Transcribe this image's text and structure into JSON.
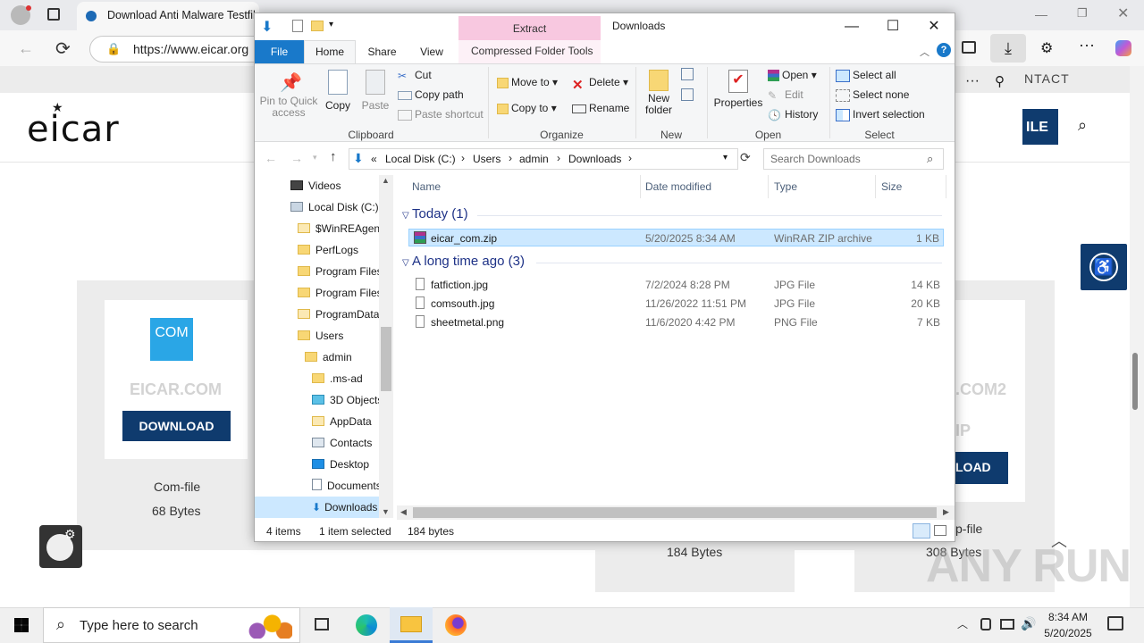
{
  "browser": {
    "tab_title": "Download Anti Malware Testfile",
    "url": "https://www.eicar.org",
    "icons": [
      "profile-icon",
      "tab-actions-icon",
      "back-icon",
      "refresh-icon",
      "site-info-icon",
      "split-screen-icon",
      "collections-icon",
      "downloads-icon",
      "extensions-icon",
      "more-icon",
      "copilot-icon",
      "minimize-icon",
      "restore-icon",
      "close-icon"
    ]
  },
  "site": {
    "nav_contact": "NTACT",
    "logo": "eicar",
    "file_button": "ILE",
    "card1": {
      "icon_text": "COM",
      "title": "EICAR.COM",
      "download": "DOWNLOAD",
      "name": "Com-file",
      "size": "68 Bytes"
    },
    "card4": {
      "title": ".COM2",
      "subtitle": "IP",
      "download": "LOAD",
      "name": "p-file"
    },
    "size3": "184 Bytes",
    "size4": "308 Bytes",
    "watermark": "ANY RUN"
  },
  "explorer": {
    "title": "Downloads",
    "extract_tab": "Extract",
    "compressed_tab": "Compressed Folder Tools",
    "tabs": [
      "File",
      "Home",
      "Share",
      "View"
    ],
    "ribbon": {
      "clipboard": {
        "label": "Clipboard",
        "pin": "Pin to Quick access",
        "copy": "Copy",
        "paste": "Paste",
        "cut": "Cut",
        "copy_path": "Copy path",
        "paste_shortcut": "Paste shortcut"
      },
      "organize": {
        "label": "Organize",
        "move_to": "Move to",
        "copy_to": "Copy to",
        "delete": "Delete",
        "rename": "Rename"
      },
      "new": {
        "label": "New",
        "new_folder": "New folder"
      },
      "open": {
        "label": "Open",
        "properties": "Properties",
        "open": "Open",
        "edit": "Edit",
        "history": "History"
      },
      "select": {
        "label": "Select",
        "select_all": "Select all",
        "select_none": "Select none",
        "invert": "Invert selection"
      }
    },
    "address": {
      "prefix": "«",
      "crumbs": [
        "Local Disk (C:)",
        "Users",
        "admin",
        "Downloads"
      ]
    },
    "search_placeholder": "Search Downloads",
    "nav_items": [
      "Videos",
      "Local Disk (C:)",
      "$WinREAgent",
      "PerfLogs",
      "Program Files",
      "Program Files",
      "ProgramData",
      "Users",
      "admin",
      ".ms-ad",
      "3D Objects",
      "AppData",
      "Contacts",
      "Desktop",
      "Documents",
      "Downloads"
    ],
    "columns": [
      "Name",
      "Date modified",
      "Type",
      "Size"
    ],
    "groups": [
      {
        "title": "Today (1)",
        "files": [
          {
            "name": "eicar_com.zip",
            "date": "5/20/2025 8:34 AM",
            "type": "WinRAR ZIP archive",
            "size": "1 KB"
          }
        ]
      },
      {
        "title": "A long time ago (3)",
        "files": [
          {
            "name": "fatfiction.jpg",
            "date": "7/2/2024 8:28 PM",
            "type": "JPG File",
            "size": "14 KB"
          },
          {
            "name": "comsouth.jpg",
            "date": "11/26/2022 11:51 PM",
            "type": "JPG File",
            "size": "20 KB"
          },
          {
            "name": "sheetmetal.png",
            "date": "11/6/2020 4:42 PM",
            "type": "PNG File",
            "size": "7 KB"
          }
        ]
      }
    ],
    "status": {
      "items": "4 items",
      "selected": "1 item selected",
      "size": "184 bytes"
    }
  },
  "taskbar": {
    "search_placeholder": "Type here to search",
    "time": "8:34 AM",
    "date": "5/20/2025"
  }
}
